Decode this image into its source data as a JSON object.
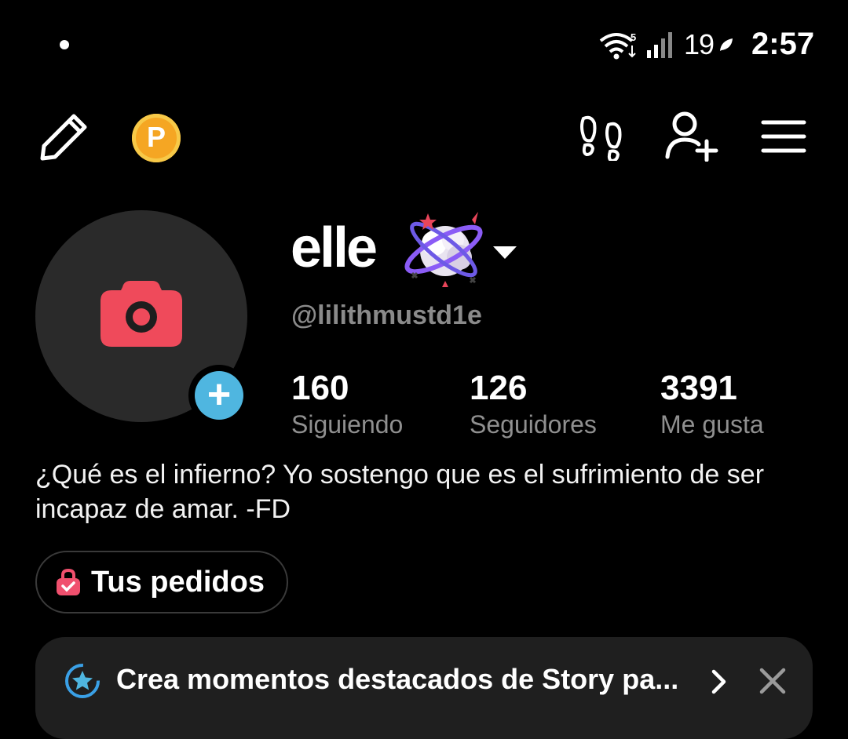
{
  "status_bar": {
    "wifi_badge": "5",
    "battery": "19",
    "time": "2:57"
  },
  "icons": {
    "edit": "pencil-icon",
    "coins": "coin-icon",
    "coin_letter": "P",
    "visitors": "footprints-icon",
    "add_friend": "add-user-icon",
    "menu": "menu-icon"
  },
  "profile": {
    "display_name": "elle",
    "username": "@lilithmustd1e",
    "add_avatar_symbol": "+",
    "stats": [
      {
        "value": "160",
        "label": "Siguiendo"
      },
      {
        "value": "126",
        "label": "Seguidores"
      },
      {
        "value": "3391",
        "label": "Me gusta"
      }
    ],
    "bio": "¿Qué es el infierno? Yo sostengo que es el sufrimiento de ser incapaz de amar. -FD"
  },
  "orders": {
    "label": "Tus pedidos"
  },
  "story_banner": {
    "text": "Crea momentos destacados de Story pa..."
  },
  "colors": {
    "background": "#000000",
    "camera": "#ef4a5b",
    "add_avatar": "#4fb6e0",
    "coin": "#f5a623",
    "muted_text": "#8a8a8a"
  }
}
